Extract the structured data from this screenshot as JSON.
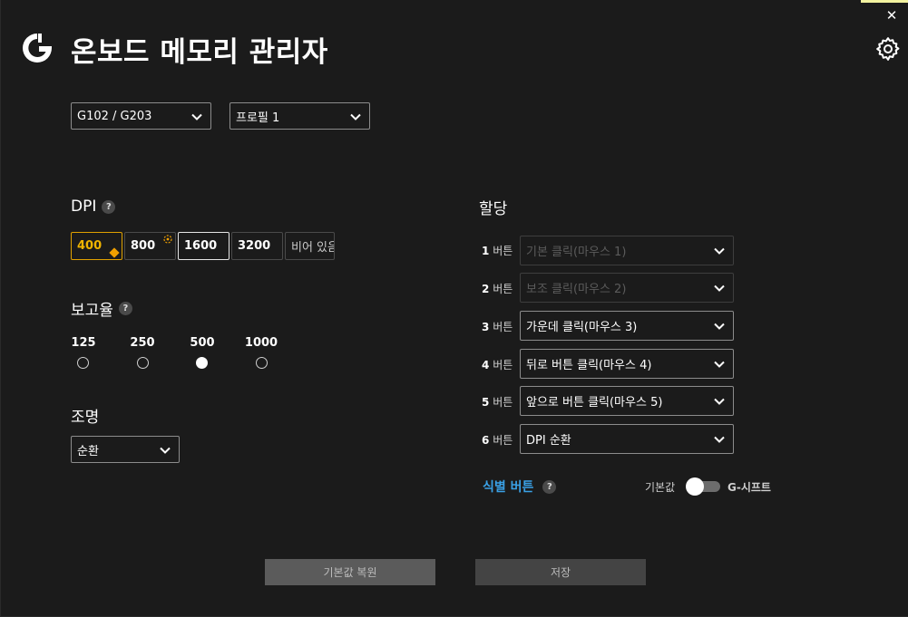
{
  "window": {
    "title": "온보드 메모리 관리자",
    "close_glyph": "✕",
    "accent_color": "#f3f3a0"
  },
  "icons": {
    "logo": "logitech-g-logo",
    "settings": "gear-icon",
    "close": "close-icon"
  },
  "selectors": {
    "device": "G102 / G203",
    "profile": "프로필 1"
  },
  "dpi": {
    "label": "DPI",
    "help": "?",
    "levels": [
      "400",
      "800",
      "1600",
      "3200",
      "비어 있음"
    ],
    "active_color": "#f0b400"
  },
  "report_rate": {
    "label": "보고율",
    "help": "?",
    "options": [
      "125",
      "250",
      "500",
      "1000"
    ],
    "selected": "500"
  },
  "lighting": {
    "label": "조명",
    "value": "순환"
  },
  "assignments": {
    "label": "할당",
    "button_word": "버튼",
    "rows": [
      {
        "num": "1",
        "value": "기본 클릭(마우스 1)",
        "disabled": true
      },
      {
        "num": "2",
        "value": "보조 클릭(마우스 2)",
        "disabled": true
      },
      {
        "num": "3",
        "value": "가운데 클릭(마우스 3)",
        "disabled": false
      },
      {
        "num": "4",
        "value": "뒤로 버튼 클릭(마우스 4)",
        "disabled": false
      },
      {
        "num": "5",
        "value": "앞으로 버튼 클릭(마우스 5)",
        "disabled": false
      },
      {
        "num": "6",
        "value": "DPI 순환",
        "disabled": false
      }
    ],
    "identify_label": "식별 버튼",
    "identify_color": "#3aa1e6",
    "toggle_left": "기본값",
    "toggle_right": "G-시프트"
  },
  "footer": {
    "restore": "기본값 복원",
    "save": "저장"
  }
}
